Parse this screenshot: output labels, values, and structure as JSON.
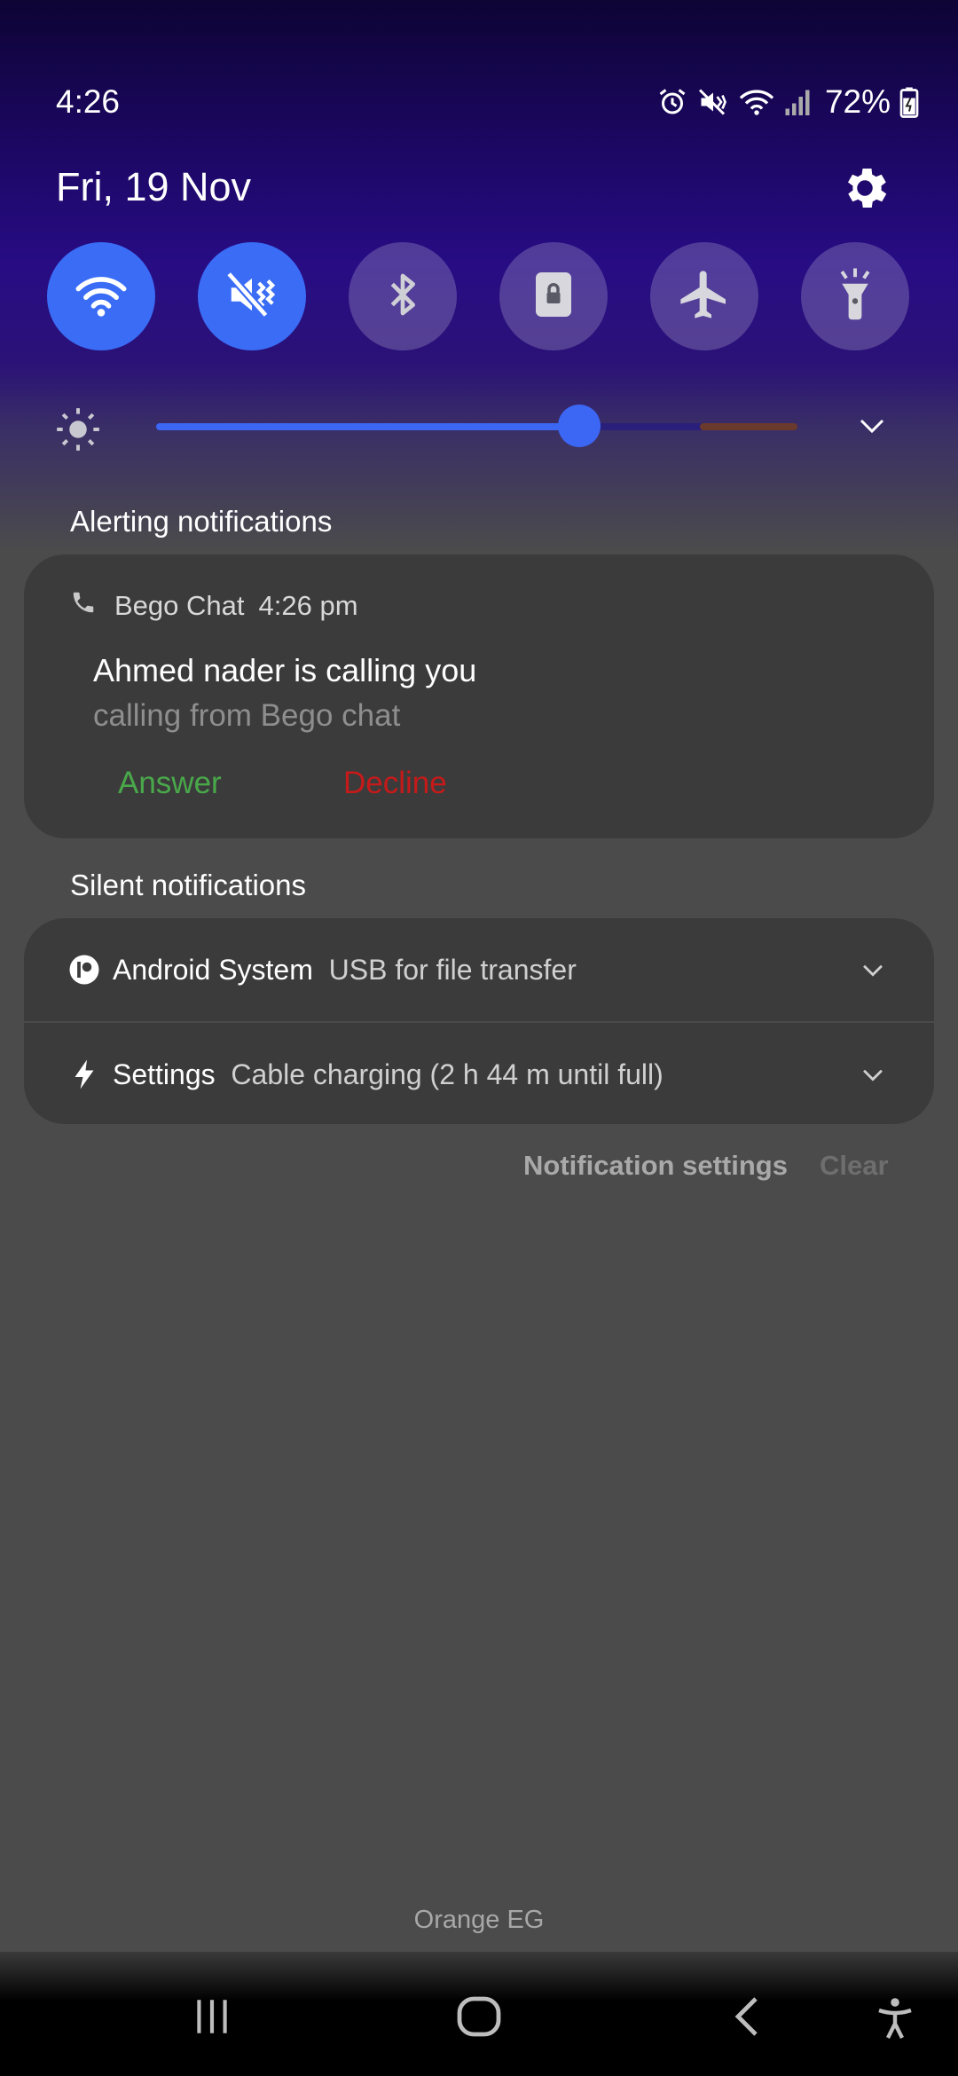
{
  "status_bar": {
    "time": "4:26",
    "battery": "72%",
    "icons": [
      "alarm-icon",
      "mute-icon",
      "wifi-icon",
      "cell-signal-icon",
      "battery-charging-icon"
    ]
  },
  "header": {
    "date": "Fri, 19 Nov",
    "settings_icon": "gear-icon"
  },
  "quick_settings": [
    {
      "name": "wifi",
      "icon": "wifi-icon",
      "state": "on"
    },
    {
      "name": "mute",
      "icon": "mute-vibrate-icon",
      "state": "on"
    },
    {
      "name": "bluetooth",
      "icon": "bluetooth-icon",
      "state": "off"
    },
    {
      "name": "rotation-lock",
      "icon": "portrait-lock-icon",
      "state": "off"
    },
    {
      "name": "airplane",
      "icon": "airplane-icon",
      "state": "off"
    },
    {
      "name": "flashlight",
      "icon": "flashlight-icon",
      "state": "off"
    }
  ],
  "brightness": {
    "level_percent": 66
  },
  "alerting": {
    "heading": "Alerting notifications",
    "call": {
      "app": "Bego Chat",
      "time": "4:26 pm",
      "title": "Ahmed nader is calling you",
      "subtitle": "calling from Bego chat",
      "answer_label": "Answer",
      "decline_label": "Decline"
    }
  },
  "silent": {
    "heading": "Silent notifications",
    "items": [
      {
        "app": "Android System",
        "text": "USB for file transfer",
        "icon": "android-system-icon"
      },
      {
        "app": "Settings",
        "text": "Cable charging (2 h 44 m until full)",
        "icon": "charging-bolt-icon"
      }
    ]
  },
  "footer": {
    "notification_settings": "Notification settings",
    "clear": "Clear",
    "carrier": "Orange EG"
  },
  "colors": {
    "accent": "#3a6cf6",
    "answer": "#49a84a",
    "decline": "#c61a1a"
  }
}
